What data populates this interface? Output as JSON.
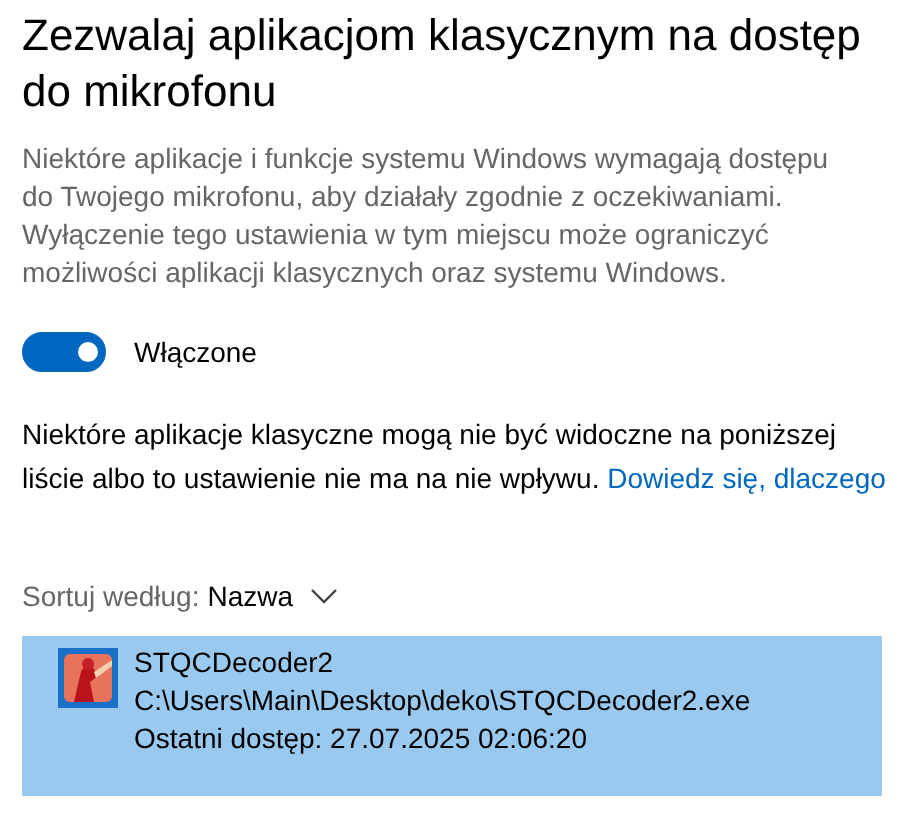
{
  "title": "Zezwalaj aplikacjom klasycznym na dostęp do mikrofonu",
  "description": "Niektóre aplikacje i funkcje systemu Windows wymagają dostępu do Twojego mikrofonu, aby działały zgodnie z oczekiwaniami. Wyłączenie tego ustawienia w tym miejscu może ograniczyć możliwości aplikacji klasycznych oraz systemu Windows.",
  "toggle": {
    "on": true,
    "label": "Włączone"
  },
  "note": {
    "text": "Niektóre aplikacje klasyczne mogą nie być widoczne na poniższej liście albo to ustawienie nie ma na nie wpływu.",
    "link": "Dowiedz się, dlaczego"
  },
  "sort": {
    "label": "Sortuj według:",
    "value": "Nazwa"
  },
  "apps": [
    {
      "name": "STQCDecoder2",
      "path": "C:\\Users\\Main\\Desktop\\deko\\STQCDecoder2.exe",
      "last_access": "Ostatni dostęp: 27.07.2025 02:06:20",
      "selected": true
    }
  ]
}
